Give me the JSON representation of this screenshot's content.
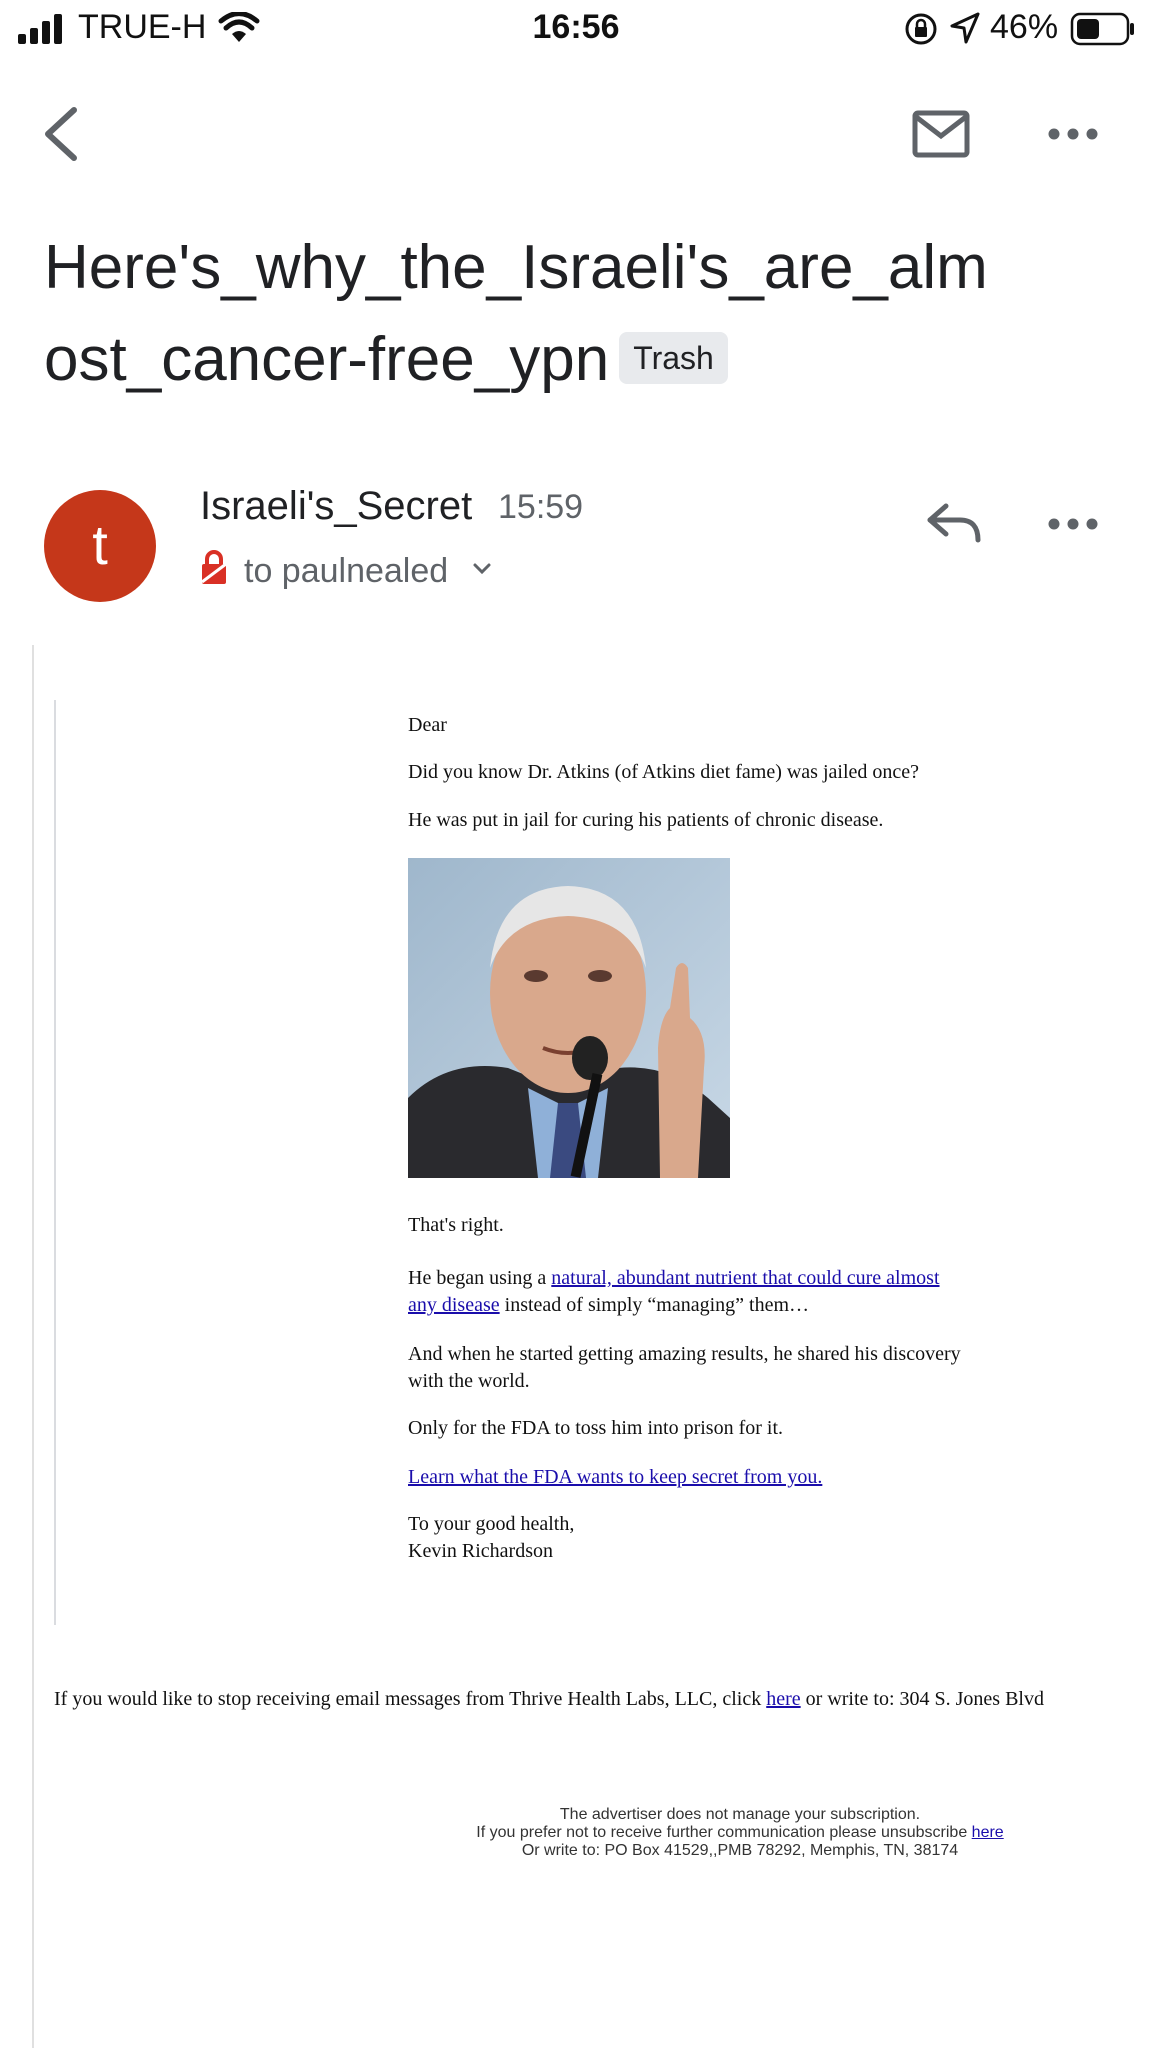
{
  "status_bar": {
    "carrier": "TRUE-H",
    "time": "16:56",
    "battery": "46%"
  },
  "email": {
    "subject": "Here's_why_the_Israeli's_are_almost_cancer-free_ypn",
    "label": "Trash",
    "sender": "Israeli's_Secret",
    "time": "15:59",
    "recipient": "to paulnealed"
  },
  "body": {
    "greeting": "Dear",
    "p1": "Did you know Dr. Atkins (of Atkins diet fame) was jailed once?",
    "p2": "He was put in jail for curing his patients of chronic disease.",
    "p3": "That's right.",
    "p4_pre": "He began using a ",
    "p4_link": "natural, abundant nutrient that could cure almost any disease",
    "p4_post": " instead of simply “managing” them…",
    "p5": "And when he started getting amazing results, he shared his discovery with the world.",
    "p6": "Only for the FDA to toss him into prison for it.",
    "cta_link": "Learn what the FDA wants to keep secret from you.",
    "closing": "To your good health,",
    "signature": "Kevin Richardson"
  },
  "unsubscribe": {
    "pre": "If you would like to stop receiving email messages from Thrive Health Labs, LLC, click ",
    "link": "here",
    "post": " or write to: 304 S. Jones Blvd"
  },
  "footer": {
    "line1": "The advertiser does not manage your subscription.",
    "line2_pre": "If you prefer not to receive further communication please unsubscribe ",
    "line2_link": "here",
    "line3": "Or write to: PO Box 41529,,PMB 78292, Memphis, TN, 38174"
  },
  "colors": {
    "avatar": "#c5371a",
    "link": "#1a0dab",
    "lock": "#d93025"
  },
  "icons": [
    "signal-icon",
    "wifi-icon",
    "rotation-lock-icon",
    "location-arrow-icon",
    "battery-icon",
    "back-arrow-icon",
    "mail-icon",
    "more-icon",
    "reply-icon",
    "lock-icon",
    "chevron-down-icon"
  ]
}
